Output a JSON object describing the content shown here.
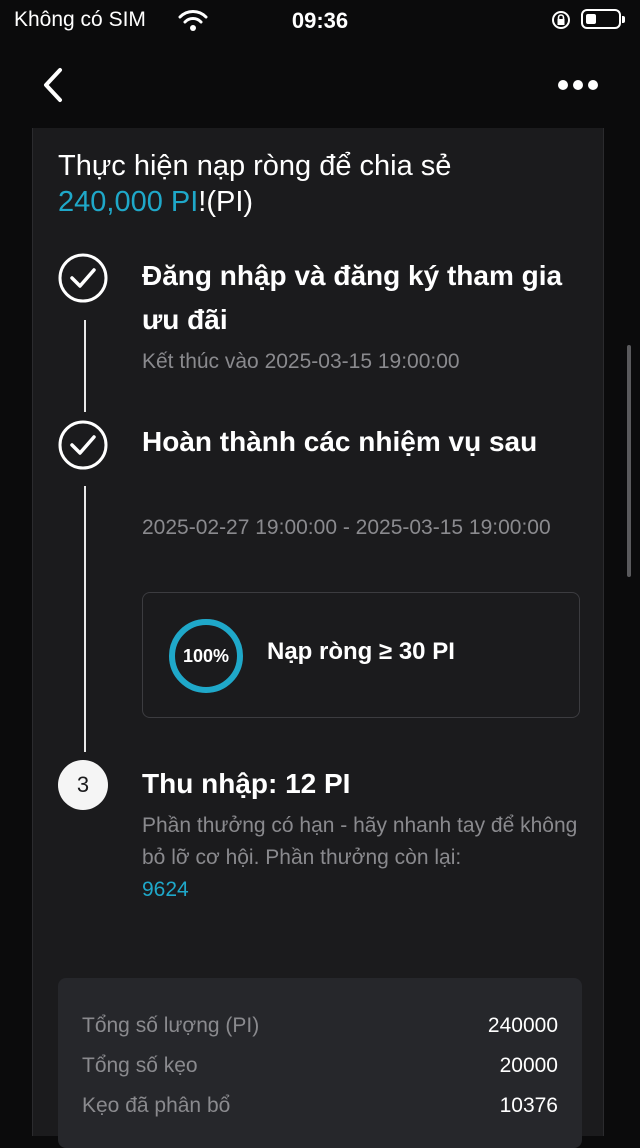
{
  "status_bar": {
    "carrier": "Không có SIM",
    "time": "09:36"
  },
  "nav": {
    "back_icon": "chevron-left-icon",
    "more_icon": "ellipsis-icon"
  },
  "headline": {
    "prefix": "Thực hiện nạp ròng để chia sẻ",
    "amount": "240,000 PI",
    "suffix": "!(PI)"
  },
  "steps": [
    {
      "state": "done",
      "title": "Đăng nhập và đăng ký tham gia ưu đãi",
      "subtitle": "Kết thúc vào 2025-03-15 19:00:00"
    },
    {
      "state": "done",
      "title": "Hoàn thành các nhiệm vụ sau",
      "subtitle": "2025-02-27 19:00:00 - 2025-03-15 19:00:00",
      "task": {
        "progress_label": "100%",
        "progress_value": 1.0,
        "label": "Nạp ròng ≥ 30 PI"
      }
    },
    {
      "state": "pending",
      "number": "3",
      "title": "Thu nhập: 12 PI",
      "subtitle": "Phần thưởng có hạn - hãy nhanh tay để không bỏ lỡ cơ hội. Phần thưởng còn lại:",
      "remaining": "9624"
    }
  ],
  "summary": [
    {
      "label": "Tổng số lượng (PI)",
      "value": "240000"
    },
    {
      "label": "Tổng số kẹo",
      "value": "20000"
    },
    {
      "label": "Kẹo đã phân bổ",
      "value": "10376"
    }
  ],
  "colors": {
    "accent": "#1fa8c9",
    "background": "#0b0b0c",
    "card": "#1b1b1d",
    "muted_text": "#8a8a8e"
  }
}
